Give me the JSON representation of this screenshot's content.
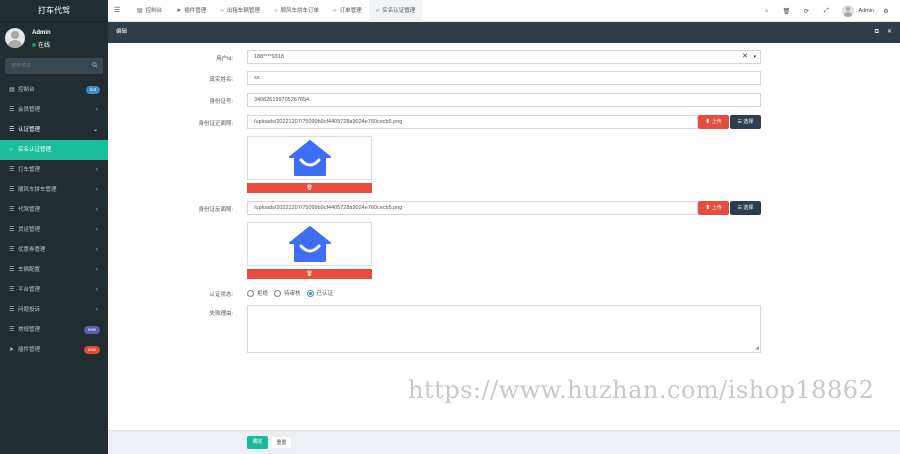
{
  "app": {
    "title": "打车代驾"
  },
  "user": {
    "name": "Admin",
    "status": "在线"
  },
  "search": {
    "placeholder": "搜索菜单"
  },
  "sidebar": {
    "items": [
      {
        "label": "控制台",
        "icon": "dashboard-icon",
        "badge": "hot",
        "badge_color": "#3c8dbc"
      },
      {
        "label": "会员管理",
        "icon": "list-icon",
        "chevron": "‹"
      },
      {
        "label": "认证管理",
        "icon": "list-icon",
        "chevron": "⌄"
      },
      {
        "label": "实名认证管理",
        "icon": "circle-icon"
      },
      {
        "label": "打车管理",
        "icon": "list-icon",
        "chevron": "‹"
      },
      {
        "label": "顺风车拼车管理",
        "icon": "list-icon",
        "chevron": "‹"
      },
      {
        "label": "代驾管理",
        "icon": "list-icon",
        "chevron": "‹"
      },
      {
        "label": "货运管理",
        "icon": "list-icon",
        "chevron": "‹"
      },
      {
        "label": "优惠券管理",
        "icon": "list-icon",
        "chevron": "‹"
      },
      {
        "label": "车辆配置",
        "icon": "list-icon",
        "chevron": "‹"
      },
      {
        "label": "平台管理",
        "icon": "list-icon",
        "chevron": "‹"
      },
      {
        "label": "问题投诉",
        "icon": "list-icon",
        "chevron": "‹"
      },
      {
        "label": "常规管理",
        "icon": "list-icon",
        "badge": "new",
        "badge_color": "#605ca8"
      },
      {
        "label": "插件管理",
        "icon": "rocket-icon",
        "badge": "new",
        "badge_color": "#dd4b39"
      }
    ]
  },
  "tabs": [
    {
      "label": "控制台",
      "icon": "dashboard-icon"
    },
    {
      "label": "插件管理",
      "icon": "rocket-icon"
    },
    {
      "label": "出租车辆管理",
      "icon": "circle-icon"
    },
    {
      "label": "顺风车拼车订单",
      "icon": "circle-icon"
    },
    {
      "label": "订单管理",
      "icon": "circle-icon"
    },
    {
      "label": "实名认证管理",
      "icon": "circle-icon"
    }
  ],
  "topbar": {
    "user": "Admin"
  },
  "panel": {
    "title": "编辑"
  },
  "form": {
    "user_id_label": "用户id:",
    "user_id_value": "188****9318",
    "real_name_label": "真实姓名:",
    "real_name_value": "ss",
    "id_card_label": "身份证号:",
    "id_card_value": "340826199705267654",
    "front_label": "身份证正面照:",
    "front_value": "/uploads/20221207/75099b9cf4405728a9024e760cecb5.png",
    "back_label": "身份证反面照:",
    "back_value": "/uploads/20221207/75099b9cf4405728a9024e760cecb5.png",
    "upload_label": "上传",
    "choose_label": "选择",
    "status_label": "认证状态:",
    "status_options": [
      "拒绝",
      "待审核",
      "已认证"
    ],
    "reason_label": "失败理由:"
  },
  "footer": {
    "ok_label": "确定",
    "reset_label": "重置"
  },
  "watermark": "https://www.huzhan.com/ishop18862"
}
